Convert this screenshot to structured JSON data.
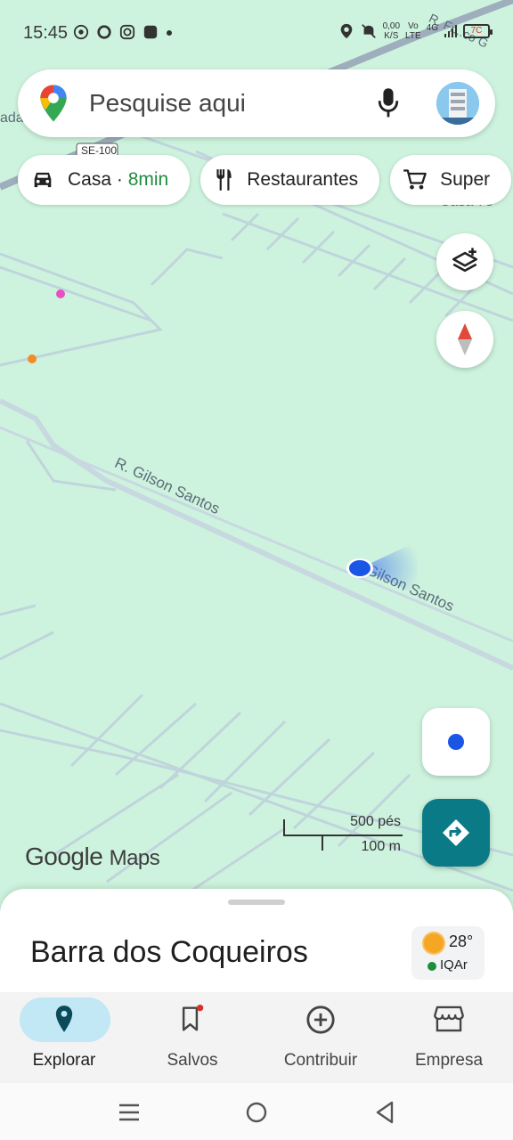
{
  "status_bar": {
    "time": "15:45",
    "net_speed_top": "0,00",
    "net_speed_bottom": "K/S",
    "volte_top": "Vo",
    "volte_bottom": "LTE",
    "signal_type": "4G",
    "battery": "7C"
  },
  "search": {
    "placeholder": "Pesquise aqui",
    "mic_icon": "mic-icon"
  },
  "chips": [
    {
      "icon": "car-icon",
      "label": "Casa · ",
      "accent": "8min"
    },
    {
      "icon": "restaurant-icon",
      "label": "Restaurantes"
    },
    {
      "icon": "cart-icon",
      "label": "Super"
    }
  ],
  "map": {
    "road_labels": [
      "R. Gilson Santos",
      "Gilson Santos",
      "SE-100",
      "Casa 78",
      "R. Fr...co G",
      "ada"
    ],
    "scale_ft": "500 pés",
    "scale_m": "100 m",
    "logo_google": "Google",
    "logo_maps": "Maps"
  },
  "sheet": {
    "place": "Barra dos Coqueiros",
    "temperature": "28°",
    "air_quality": "IQAr"
  },
  "nav": [
    {
      "label": "Explorar",
      "icon": "pin-icon",
      "active": true
    },
    {
      "label": "Salvos",
      "icon": "bookmark-icon"
    },
    {
      "label": "Contribuir",
      "icon": "add-circle-icon"
    },
    {
      "label": "Empresa",
      "icon": "store-icon"
    }
  ],
  "colors": {
    "map_bg": "#cdf3de",
    "road": "#b7cdd6",
    "accent_green": "#1e8e3e",
    "directions": "#0b7a87",
    "location_blue": "#1a55e6"
  }
}
